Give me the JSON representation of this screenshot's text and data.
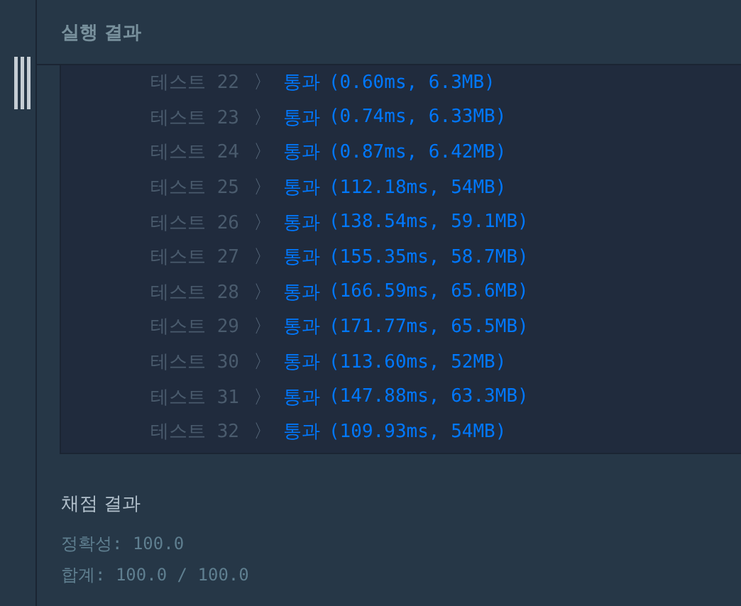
{
  "panel": {
    "title": "실행 결과"
  },
  "tests": [
    {
      "label": "테스트 22",
      "separator": "〉",
      "status": "통과",
      "detail": "(0.60ms, 6.3MB)"
    },
    {
      "label": "테스트 23",
      "separator": "〉",
      "status": "통과",
      "detail": "(0.74ms, 6.33MB)"
    },
    {
      "label": "테스트 24",
      "separator": "〉",
      "status": "통과",
      "detail": "(0.87ms, 6.42MB)"
    },
    {
      "label": "테스트 25",
      "separator": "〉",
      "status": "통과",
      "detail": "(112.18ms, 54MB)"
    },
    {
      "label": "테스트 26",
      "separator": "〉",
      "status": "통과",
      "detail": "(138.54ms, 59.1MB)"
    },
    {
      "label": "테스트 27",
      "separator": "〉",
      "status": "통과",
      "detail": "(155.35ms, 58.7MB)"
    },
    {
      "label": "테스트 28",
      "separator": "〉",
      "status": "통과",
      "detail": "(166.59ms, 65.6MB)"
    },
    {
      "label": "테스트 29",
      "separator": "〉",
      "status": "통과",
      "detail": "(171.77ms, 65.5MB)"
    },
    {
      "label": "테스트 30",
      "separator": "〉",
      "status": "통과",
      "detail": "(113.60ms, 52MB)"
    },
    {
      "label": "테스트 31",
      "separator": "〉",
      "status": "통과",
      "detail": "(147.88ms, 63.3MB)"
    },
    {
      "label": "테스트 32",
      "separator": "〉",
      "status": "통과",
      "detail": "(109.93ms, 54MB)"
    }
  ],
  "grading": {
    "title": "채점 결과",
    "lines": [
      "정확성: 100.0",
      "합계: 100.0 / 100.0"
    ]
  }
}
